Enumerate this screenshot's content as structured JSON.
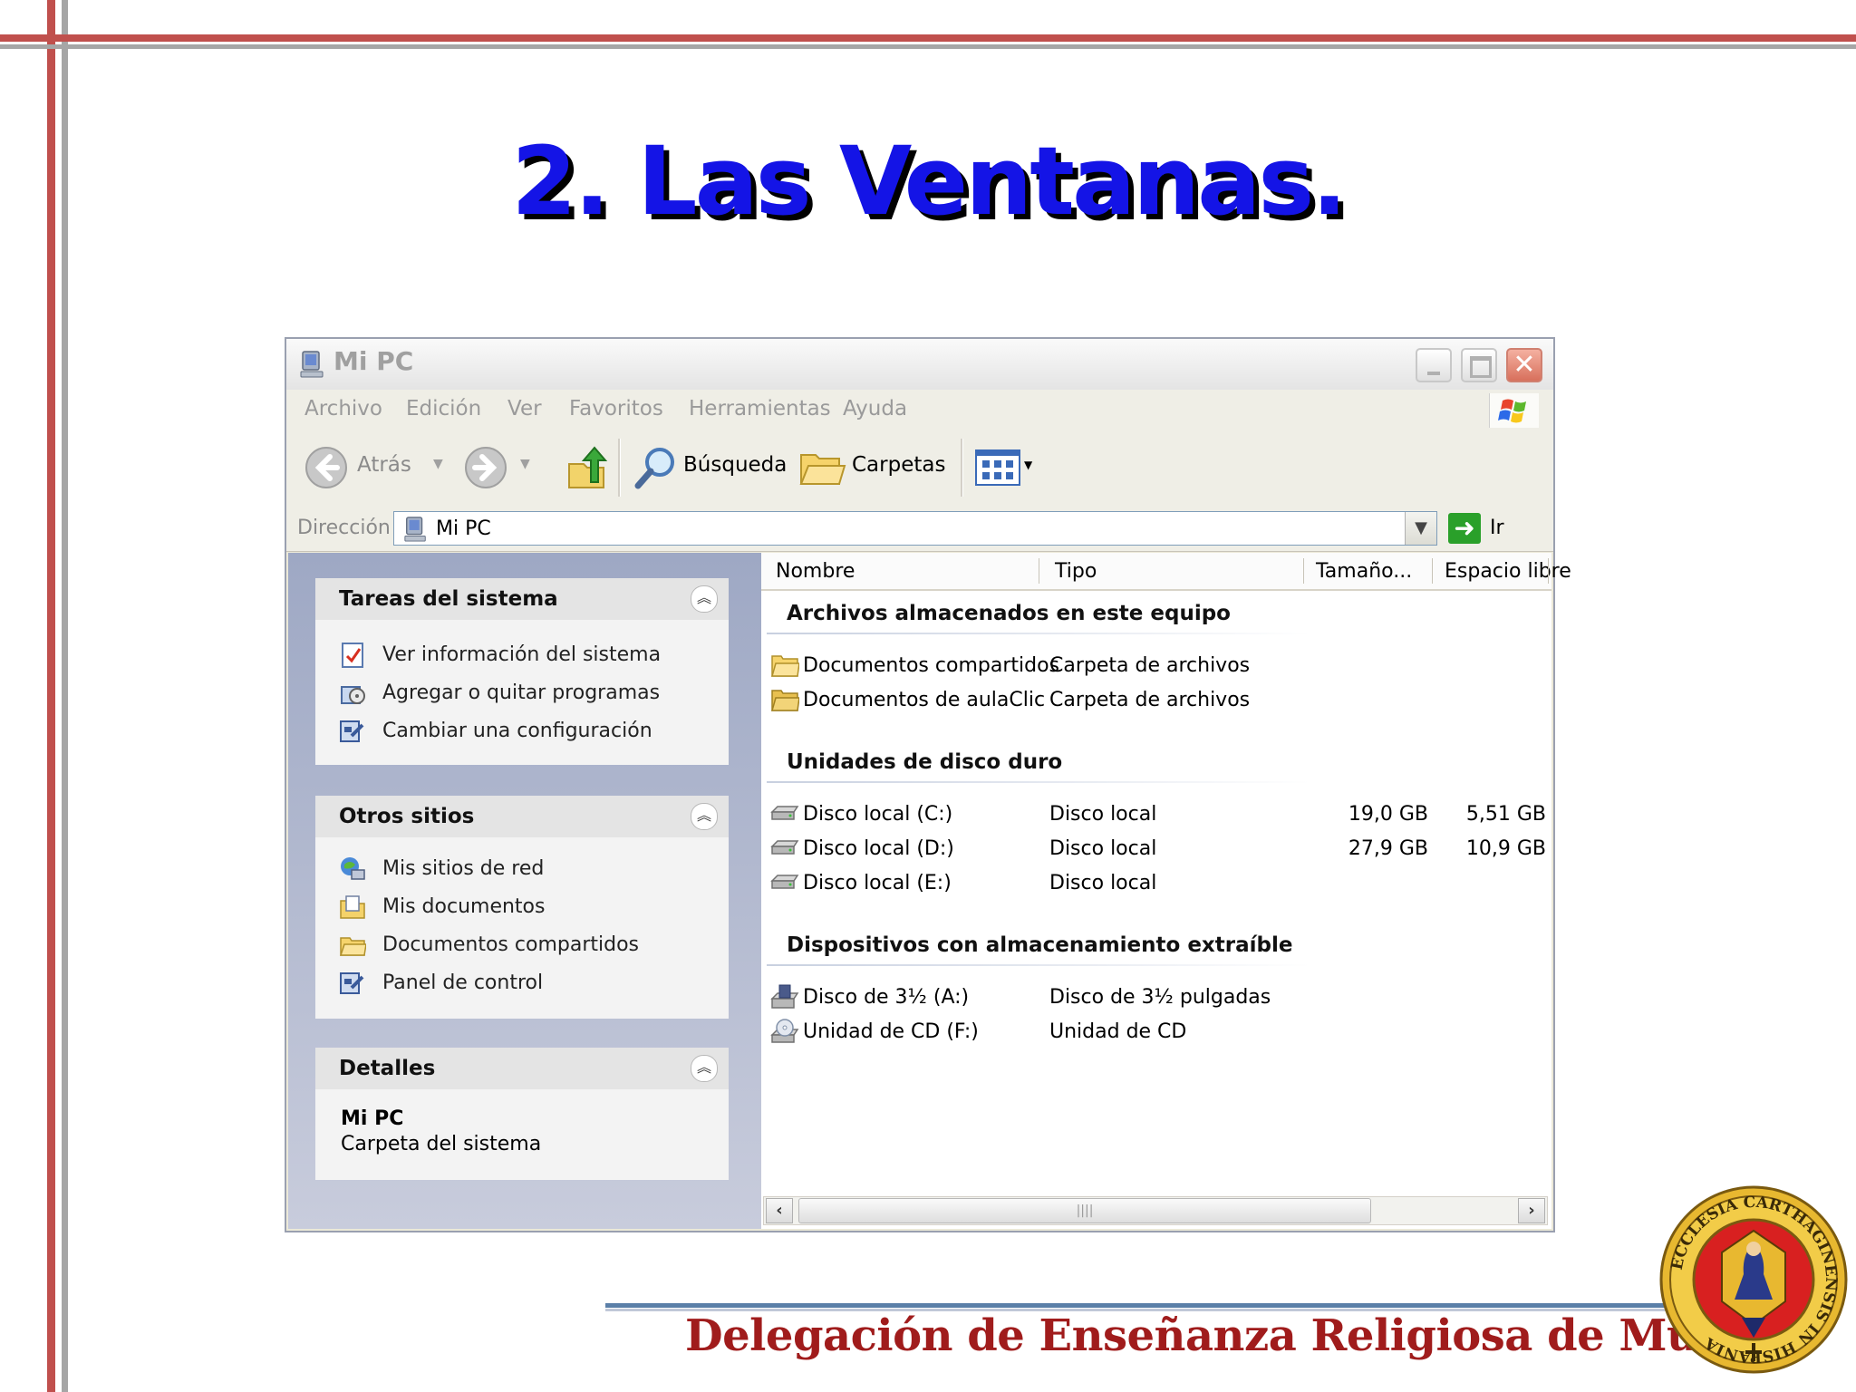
{
  "slide": {
    "title": "2. Las Ventanas.",
    "footer": "Delegación de Enseñanza Religiosa de Murcia",
    "seal_text": "ECCLESIA CARTHAGINENSIS IN HISPANIA"
  },
  "window": {
    "title": "Mi PC",
    "menu": [
      "Archivo",
      "Edición",
      "Ver",
      "Favoritos",
      "Herramientas",
      "Ayuda"
    ],
    "toolbar": {
      "back_label": "Atrás",
      "search_label": "Búsqueda",
      "folders_label": "Carpetas"
    },
    "address": {
      "label": "Dirección",
      "value": "Mi PC",
      "go_label": "Ir"
    }
  },
  "taskpane": {
    "system_tasks": {
      "title": "Tareas del sistema",
      "items": [
        "Ver información del sistema",
        "Agregar o quitar programas",
        "Cambiar una configuración"
      ]
    },
    "other_places": {
      "title": "Otros sitios",
      "items": [
        "Mis sitios de red",
        "Mis documentos",
        "Documentos compartidos",
        "Panel de control"
      ]
    },
    "details": {
      "title": "Detalles",
      "name": "Mi PC",
      "description": "Carpeta del sistema"
    }
  },
  "list": {
    "columns": [
      "Nombre",
      "Tipo",
      "Tamaño...",
      "Espacio libre"
    ],
    "groups": [
      {
        "title": "Archivos almacenados en este equipo",
        "rows": [
          {
            "name": "Documentos compartidos",
            "type": "Carpeta de archivos",
            "size": "",
            "free": ""
          },
          {
            "name": "Documentos de aulaClic",
            "type": "Carpeta de archivos",
            "size": "",
            "free": ""
          }
        ]
      },
      {
        "title": "Unidades de disco duro",
        "rows": [
          {
            "name": "Disco local (C:)",
            "type": "Disco local",
            "size": "19,0 GB",
            "free": "5,51 GB"
          },
          {
            "name": "Disco local (D:)",
            "type": "Disco local",
            "size": "27,9 GB",
            "free": "10,9 GB"
          },
          {
            "name": "Disco local (E:)",
            "type": "Disco local",
            "size": "",
            "free": ""
          }
        ]
      },
      {
        "title": "Dispositivos con almacenamiento extraíble",
        "rows": [
          {
            "name": "Disco de 3½ (A:)",
            "type": "Disco de 3½ pulgadas",
            "size": "",
            "free": ""
          },
          {
            "name": "Unidad de CD (F:)",
            "type": "Unidad de CD",
            "size": "",
            "free": ""
          }
        ]
      }
    ]
  },
  "colors": {
    "title_blue": "#1414e6",
    "footer_red": "#a01c1c",
    "frame_red": "#c0504d"
  }
}
